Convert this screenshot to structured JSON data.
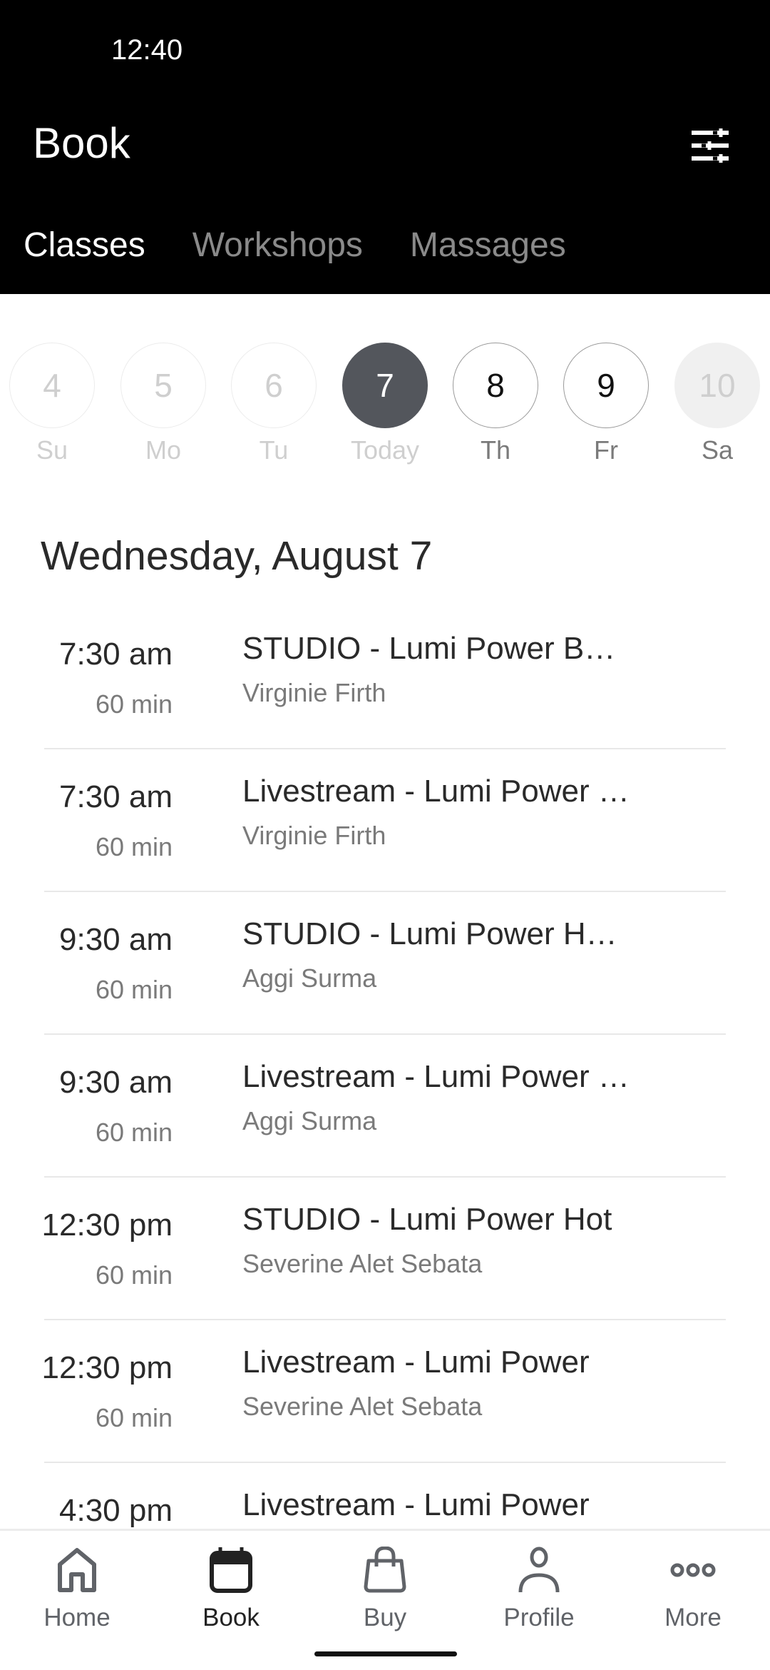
{
  "status_bar": {
    "time": "12:40"
  },
  "header": {
    "title": "Book",
    "filter_icon": "sliders-icon"
  },
  "tabs": [
    {
      "label": "Classes",
      "active": true
    },
    {
      "label": "Workshops",
      "active": false
    },
    {
      "label": "Massages",
      "active": false
    }
  ],
  "date_strip": [
    {
      "day": "4",
      "label": "Su",
      "state": "past"
    },
    {
      "day": "5",
      "label": "Mo",
      "state": "past"
    },
    {
      "day": "6",
      "label": "Tu",
      "state": "past"
    },
    {
      "day": "7",
      "label": "Today",
      "state": "today"
    },
    {
      "day": "8",
      "label": "Th",
      "state": "future"
    },
    {
      "day": "9",
      "label": "Fr",
      "state": "future"
    },
    {
      "day": "10",
      "label": "Sa",
      "state": "off"
    }
  ],
  "day_heading": "Wednesday, August 7",
  "classes": [
    {
      "time": "7:30 am",
      "duration": "60 min",
      "name": "STUDIO - Lumi Power B…",
      "teacher": "Virginie Firth"
    },
    {
      "time": "7:30 am",
      "duration": "60 min",
      "name": "Livestream - Lumi Power …",
      "teacher": "Virginie Firth"
    },
    {
      "time": "9:30 am",
      "duration": "60 min",
      "name": "STUDIO - Lumi Power H…",
      "teacher": "Aggi Surma"
    },
    {
      "time": "9:30 am",
      "duration": "60 min",
      "name": "Livestream - Lumi Power …",
      "teacher": "Aggi Surma"
    },
    {
      "time": "12:30 pm",
      "duration": "60 min",
      "name": "STUDIO - Lumi Power Hot",
      "teacher": "Severine Alet Sebata"
    },
    {
      "time": "12:30 pm",
      "duration": "60 min",
      "name": "Livestream - Lumi Power",
      "teacher": "Severine Alet Sebata"
    },
    {
      "time": "4:30 pm",
      "duration": "",
      "name": "Livestream - Lumi Power",
      "teacher": ""
    }
  ],
  "bottom_nav": [
    {
      "label": "Home",
      "icon": "home-icon",
      "active": false
    },
    {
      "label": "Book",
      "icon": "calendar-icon",
      "active": true
    },
    {
      "label": "Buy",
      "icon": "shopping-bag-icon",
      "active": false
    },
    {
      "label": "Profile",
      "icon": "person-icon",
      "active": false
    },
    {
      "label": "More",
      "icon": "more-dots-icon",
      "active": false
    }
  ],
  "colors": {
    "header_bg": "#000000",
    "today_circle": "#53565c",
    "divider": "#e8e8e8"
  }
}
